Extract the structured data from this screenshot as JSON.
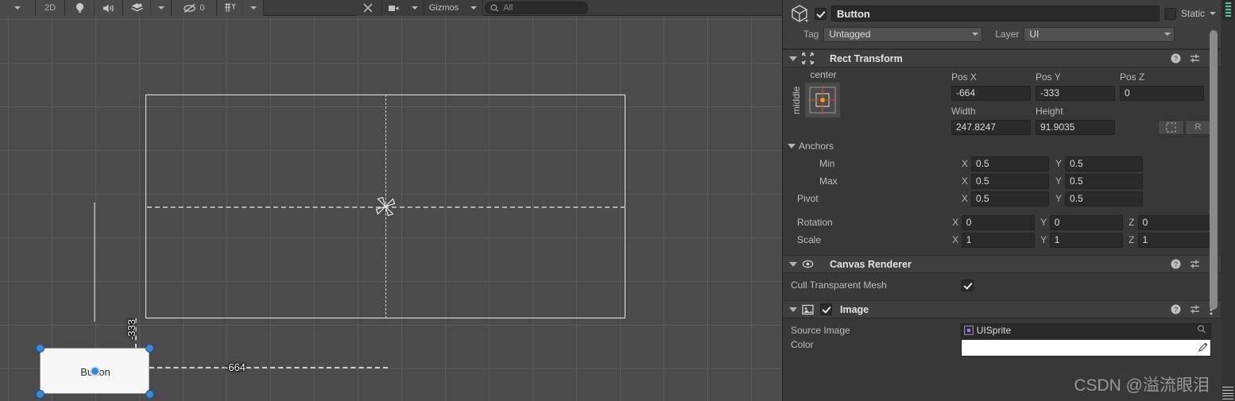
{
  "scene_toolbar": {
    "view_dropdown_icon": "chevron-down-icon",
    "mode_2d_label": "2D",
    "lighting_icon": "lightbulb-icon",
    "audio_icon": "speaker-icon",
    "fx_icon": "layers-icon",
    "fx_caret_icon": "chevron-down-icon",
    "hidden_objects_icon": "eye-off-icon",
    "hidden_objects_count": "0",
    "grid_icon": "grid-axis-icon",
    "grid_caret_icon": "chevron-down-icon",
    "tools_icon": "wrench-screwdriver-icon",
    "camera_icon": "camera-icon",
    "camera_caret_icon": "chevron-down-icon",
    "gizmos_label": "Gizmos",
    "gizmos_caret_icon": "chevron-down-icon",
    "search_icon": "search-icon",
    "search_placeholder": "All",
    "search_value": ""
  },
  "scene": {
    "selected_object_label": "Button",
    "distance_x_label": "-664",
    "distance_y_label": "-333",
    "anchor_gizmo_icon": "pinwheel-anchor-icon"
  },
  "inspector": {
    "object_icon": "gameobject-cube-icon",
    "enabled_checked": true,
    "name_value": "Button",
    "static_label": "Static",
    "static_checked": false,
    "static_caret_icon": "chevron-down-icon",
    "tag_label": "Tag",
    "tag_value": "Untagged",
    "layer_label": "Layer",
    "layer_value": "UI",
    "header_icons": {
      "help": "help-icon",
      "preset": "preset-slider-icon",
      "menu": "kebab-menu-icon"
    },
    "rect_transform": {
      "title": "Rect Transform",
      "component_icon": "rect-transform-icon",
      "anchor_preset_top_label": "center",
      "anchor_preset_side_label": "middle",
      "pos_x_label": "Pos X",
      "pos_y_label": "Pos Y",
      "pos_z_label": "Pos Z",
      "pos_x_value": "-664",
      "pos_y_value": "-333",
      "pos_z_value": "0",
      "width_label": "Width",
      "height_label": "Height",
      "width_value": "247.8247",
      "height_value": "91.9035",
      "blueprint_button_icon": "blueprint-mode-icon",
      "raw_button_label": "R",
      "anchors_label": "Anchors",
      "min_label": "Min",
      "max_label": "Max",
      "pivot_label": "Pivot",
      "min_x": "0.5",
      "min_y": "0.5",
      "max_x": "0.5",
      "max_y": "0.5",
      "pivot_x": "0.5",
      "pivot_y": "0.5",
      "rotation_label": "Rotation",
      "rot_x": "0",
      "rot_y": "0",
      "rot_z": "0",
      "scale_label": "Scale",
      "scale_x": "1",
      "scale_y": "1",
      "scale_z": "1",
      "axis_x": "X",
      "axis_y": "Y",
      "axis_z": "Z"
    },
    "canvas_renderer": {
      "title": "Canvas Renderer",
      "component_icon": "eye-icon",
      "cull_label": "Cull Transparent Mesh",
      "cull_checked": true
    },
    "image": {
      "title": "Image",
      "component_icon": "image-component-icon",
      "enabled_checked": true,
      "source_image_label": "Source Image",
      "source_image_value": "UISprite",
      "source_image_icon": "sprite-icon",
      "picker_icon": "object-picker-icon",
      "color_label": "Color",
      "color_value": "#FFFFFF",
      "eyedropper_icon": "eyedropper-icon"
    }
  },
  "watermark": {
    "text": "CSDN @溢流眼泪"
  },
  "colors": {
    "panel_bg": "#383838",
    "header_bg": "#3f3f3f",
    "field_bg": "#2a2a2a",
    "scene_bg": "#4b4b4b",
    "handle_blue": "#3b86d6",
    "anchor_red": "#cf4b3a",
    "pivot_orange": "#e8a317"
  }
}
